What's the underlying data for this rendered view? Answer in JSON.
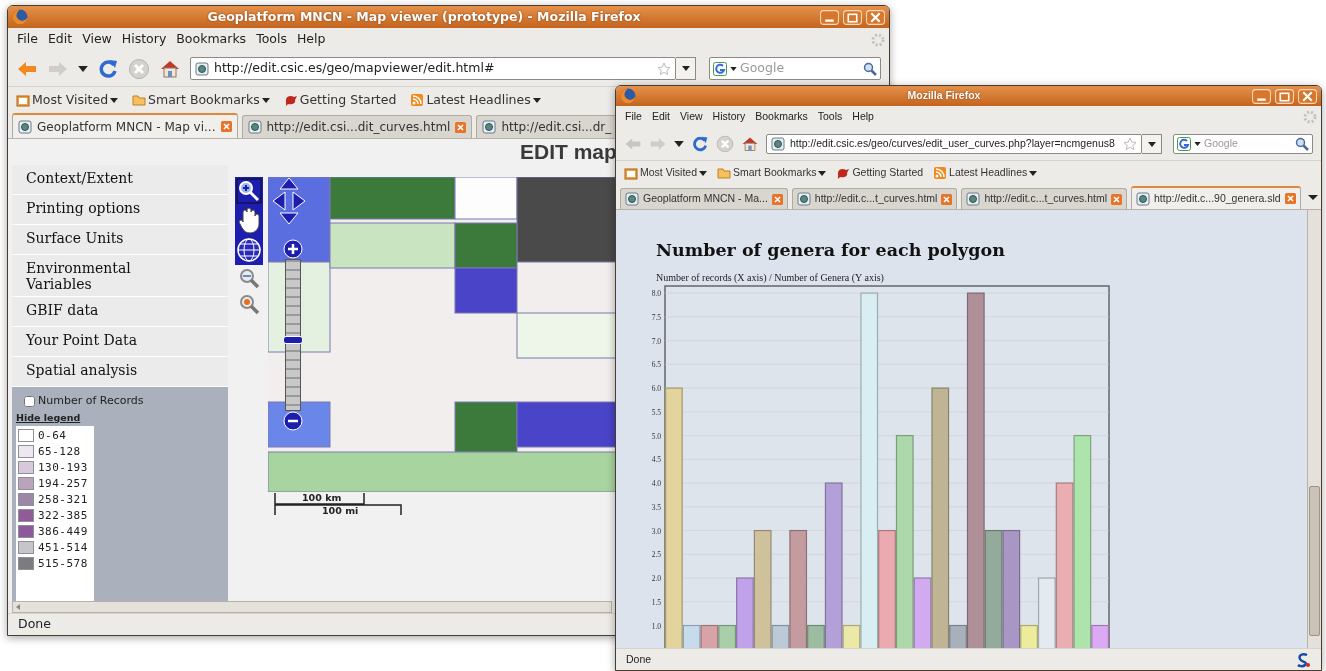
{
  "map_window": {
    "title": "Geoplatform MNCN - Map viewer (prototype) - Mozilla Firefox",
    "menu": [
      "File",
      "Edit",
      "View",
      "History",
      "Bookmarks",
      "Tools",
      "Help"
    ],
    "can_go_back": true,
    "address": "http://edit.csic.es/geo/mapviewer/edit.html#",
    "search": {
      "placeholder": "Google"
    },
    "bookmarks": [
      {
        "label": "Most Visited",
        "has_menu": true
      },
      {
        "label": "Smart Bookmarks",
        "has_menu": true
      },
      {
        "label": "Getting Started",
        "has_menu": false
      },
      {
        "label": "Latest Headlines",
        "has_menu": true
      }
    ],
    "tabs": [
      {
        "label": "Geoplatform MNCN - Map vi...",
        "selected": true,
        "close_button": true
      },
      {
        "label": "http://edit.csi...dit_curves.html",
        "selected": false,
        "close_button": true
      },
      {
        "label": "http://edit.csi...dr_",
        "selected": false,
        "close_button": false
      }
    ],
    "page": {
      "heading": "EDIT map",
      "sidebar": [
        "Context/Extent",
        "Printing options",
        "Surface Units",
        "Environmental Variables",
        "GBIF data",
        "Your Point Data",
        "Spatial analysis"
      ],
      "legend": {
        "checkbox": {
          "label": "Number of Records",
          "checked": false
        },
        "toggle": "Hide legend",
        "classes": [
          {
            "label": "0-64",
            "color": "#ffffff"
          },
          {
            "label": "65-128",
            "color": "#eee6f0"
          },
          {
            "label": "130-193",
            "color": "#d8c8dc"
          },
          {
            "label": "194-257",
            "color": "#b9a4bc"
          },
          {
            "label": "258-321",
            "color": "#9d87a6"
          },
          {
            "label": "322-385",
            "color": "#905c98"
          },
          {
            "label": "386-449",
            "color": "#8c5a98"
          },
          {
            "label": "451-514",
            "color": "#c6c6c8"
          },
          {
            "label": "515-578",
            "color": "#7c7c80"
          }
        ]
      },
      "zoom": {
        "level": 0.47
      },
      "scale": [
        "100 km",
        "100 mi"
      ]
    },
    "status": "Done"
  },
  "chart_window": {
    "title": "Mozilla Firefox",
    "menu": [
      "File",
      "Edit",
      "View",
      "History",
      "Bookmarks",
      "Tools",
      "Help"
    ],
    "can_go_back": false,
    "address": "http://edit.csic.es/geo/curves/edit_user_curves.php?layer=ncmgenus8",
    "search": {
      "placeholder": "Google"
    },
    "bookmarks": [
      {
        "label": "Most Visited",
        "has_menu": true
      },
      {
        "label": "Smart Bookmarks",
        "has_menu": true
      },
      {
        "label": "Getting Started",
        "has_menu": false
      },
      {
        "label": "Latest Headlines",
        "has_menu": true
      }
    ],
    "tabs": [
      {
        "label": "Geoplatform MNCN - Ma...",
        "selected": false,
        "close_button": true
      },
      {
        "label": "http://edit.c...t_curves.html",
        "selected": false,
        "close_button": true
      },
      {
        "label": "http://edit.c...t_curves.html",
        "selected": false,
        "close_button": true
      },
      {
        "label": "http://edit.c...90_genera.sld",
        "selected": true,
        "close_button": true
      }
    ],
    "page": {
      "heading": "Number of genera for each polygon",
      "subtitle": "Number of records (X axis) / Number of Genera (Y axis)",
      "chart_data": {
        "type": "bar",
        "grid": true,
        "ylim": [
          0,
          8.15
        ],
        "yticks": [
          {
            "value": 1,
            "label": "1.0"
          },
          {
            "value": 1.5,
            "label": "1.5"
          },
          {
            "value": 2,
            "label": "2.0"
          },
          {
            "value": 2.5,
            "label": "2.5"
          },
          {
            "value": 3,
            "label": "3.0"
          },
          {
            "value": 3.5,
            "label": "3.5"
          },
          {
            "value": 4,
            "label": "4.0"
          },
          {
            "value": 4.5,
            "label": "4.5"
          },
          {
            "value": 5,
            "label": "5.0"
          },
          {
            "value": 5.5,
            "label": "5.5"
          },
          {
            "value": 6,
            "label": "6.0"
          },
          {
            "value": 6.5,
            "label": "6.5"
          },
          {
            "value": 7,
            "label": "7.0"
          },
          {
            "value": 7.5,
            "label": "7.5"
          },
          {
            "value": 8,
            "label": "8.0"
          }
        ],
        "values": [
          6,
          1,
          1,
          1,
          2,
          3,
          1,
          3,
          1,
          4,
          1,
          8,
          3,
          5,
          2,
          6,
          1,
          8,
          3,
          3,
          1,
          2,
          4,
          5,
          1
        ],
        "colors": [
          "#e2d49c",
          "#c6dcec",
          "#d7a3a8",
          "#a8cfa8",
          "#c0a2ea",
          "#cfc19c",
          "#bccad8",
          "#c49ca0",
          "#9cbca2",
          "#b4a0d8",
          "#ece8a8",
          "#d8eef2",
          "#eaaab0",
          "#acd8ac",
          "#d2aaf0",
          "#bfb494",
          "#a8b0bc",
          "#b09098",
          "#94aa9a",
          "#a896c4",
          "#ecec9c",
          "#e4eaf0",
          "#eaaeb2",
          "#ace4ac",
          "#dcaaf4"
        ]
      }
    },
    "status": "Done"
  }
}
